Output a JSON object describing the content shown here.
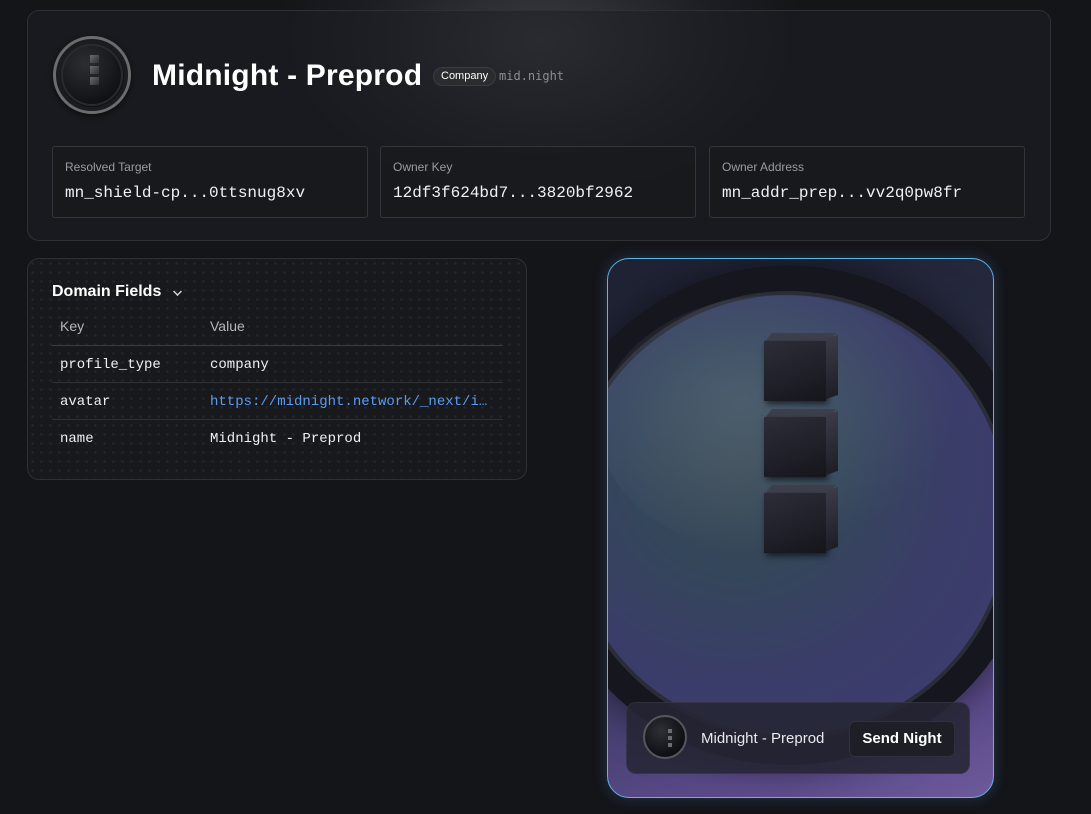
{
  "header": {
    "title": "Midnight - Preprod",
    "badge": "Company",
    "domain": "mid.night"
  },
  "info": [
    {
      "label": "Resolved Target",
      "value": "mn_shield-cp...0ttsnug8xv"
    },
    {
      "label": "Owner Key",
      "value": "12df3f624bd7...3820bf2962"
    },
    {
      "label": "Owner Address",
      "value": "mn_addr_prep...vv2q0pw8fr"
    }
  ],
  "fields": {
    "title": "Domain Fields",
    "columns": {
      "key": "Key",
      "value": "Value"
    },
    "rows": [
      {
        "key": "profile_type",
        "value": "company"
      },
      {
        "key": "avatar",
        "value": "https://midnight.network/_next/i..."
      },
      {
        "key": "name",
        "value": "Midnight - Preprod"
      }
    ]
  },
  "profile_card": {
    "name": "Midnight - Preprod",
    "send_label": "Send Night"
  },
  "icons": {
    "expand": "chevron-down-icon",
    "logo": "midnight-logo-icon"
  },
  "colors": {
    "background": "#141519",
    "link": "#5d9bf0",
    "card_border_accent": "#5fb4e6"
  }
}
